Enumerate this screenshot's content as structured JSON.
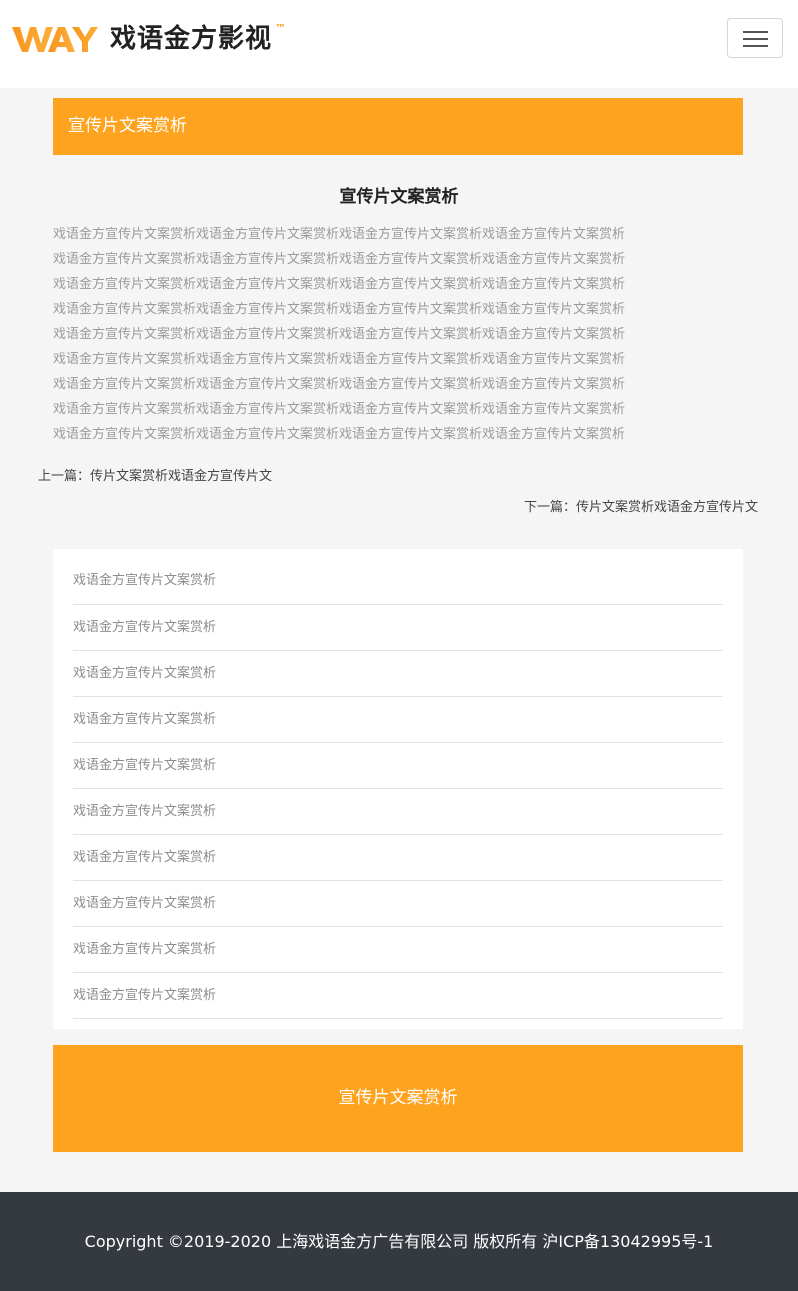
{
  "header": {
    "logo_mark_text": "WAY",
    "brand_name": "戏语金方影视",
    "brand_tm": "™",
    "menu_icon": "hamburger-menu-icon",
    "accent_color": "#fda31f"
  },
  "section": {
    "banner_title": "宣传片文案赏析"
  },
  "article": {
    "title": "宣传片文案赏析",
    "body_lines": [
      "戏语金方宣传片文案赏析戏语金方宣传片文案赏析戏语金方宣传片文案赏析戏语金方宣传片文案赏析",
      "戏语金方宣传片文案赏析戏语金方宣传片文案赏析戏语金方宣传片文案赏析戏语金方宣传片文案赏析",
      "戏语金方宣传片文案赏析戏语金方宣传片文案赏析戏语金方宣传片文案赏析戏语金方宣传片文案赏析",
      "戏语金方宣传片文案赏析戏语金方宣传片文案赏析戏语金方宣传片文案赏析戏语金方宣传片文案赏析",
      "戏语金方宣传片文案赏析戏语金方宣传片文案赏析戏语金方宣传片文案赏析戏语金方宣传片文案赏析",
      "戏语金方宣传片文案赏析戏语金方宣传片文案赏析戏语金方宣传片文案赏析戏语金方宣传片文案赏析",
      "戏语金方宣传片文案赏析戏语金方宣传片文案赏析戏语金方宣传片文案赏析戏语金方宣传片文案赏析",
      "戏语金方宣传片文案赏析戏语金方宣传片文案赏析戏语金方宣传片文案赏析戏语金方宣传片文案赏析",
      "戏语金方宣传片文案赏析戏语金方宣传片文案赏析戏语金方宣传片文案赏析戏语金方宣传片文案赏析"
    ],
    "prev_link": "上一篇：传片文案赏析戏语金方宣传片文",
    "next_link": "下一篇：传片文案赏析戏语金方宣传片文"
  },
  "related_list": [
    "戏语金方宣传片文案赏析",
    "戏语金方宣传片文案赏析",
    "戏语金方宣传片文案赏析",
    "戏语金方宣传片文案赏析",
    "戏语金方宣传片文案赏析",
    "戏语金方宣传片文案赏析",
    "戏语金方宣传片文案赏析",
    "戏语金方宣传片文案赏析",
    "戏语金方宣传片文案赏析",
    "戏语金方宣传片文案赏析"
  ],
  "cta": {
    "label": "宣传片文案赏析"
  },
  "footer": {
    "copyright": "Copyright ©2019-2020 上海戏语金方广告有限公司 版权所有 沪ICP备13042995号-1"
  }
}
